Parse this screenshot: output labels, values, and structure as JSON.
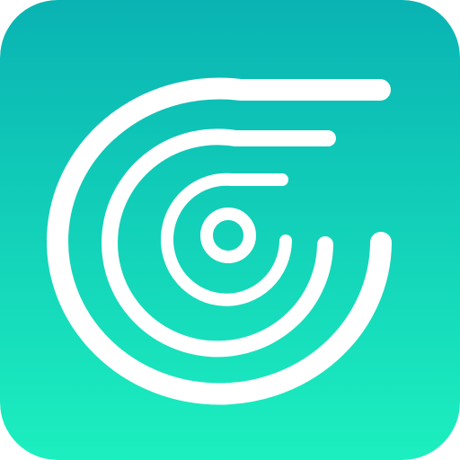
{
  "app_icon": {
    "symbol": "concentric-arcs-logo-icon",
    "colors": {
      "gradient_top": "#09B3B3",
      "gradient_bottom": "#1CEFBF",
      "glyph": "#FFFFFF"
    }
  }
}
